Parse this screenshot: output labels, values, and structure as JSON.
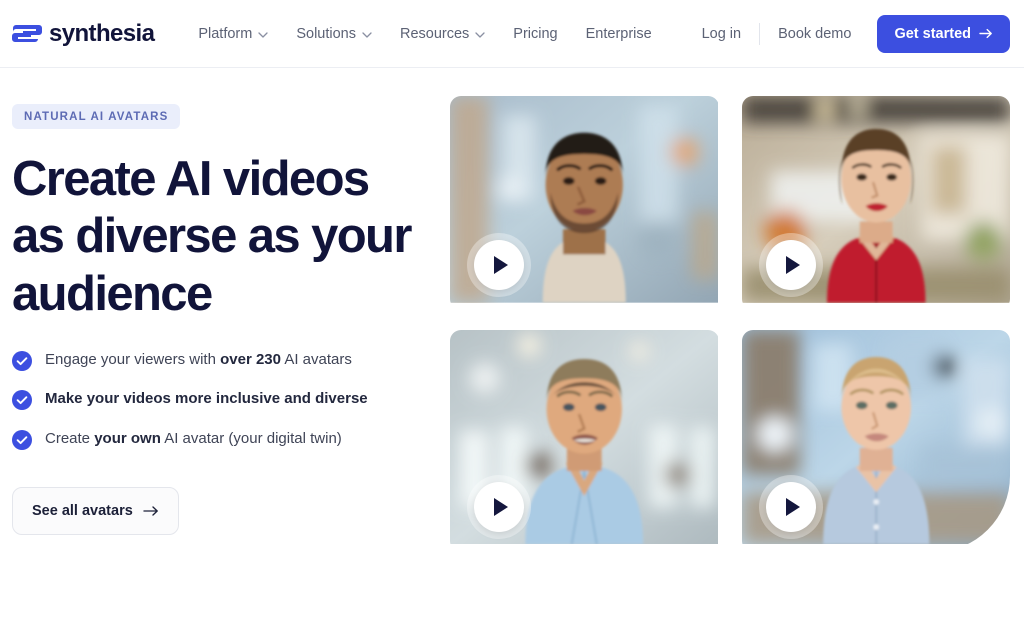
{
  "header": {
    "logo": {
      "text": "synthesia",
      "icon": "synthesia-logo-mark"
    },
    "nav": [
      {
        "label": "Platform",
        "has_dropdown": true
      },
      {
        "label": "Solutions",
        "has_dropdown": true
      },
      {
        "label": "Resources",
        "has_dropdown": true
      },
      {
        "label": "Pricing",
        "has_dropdown": false
      },
      {
        "label": "Enterprise",
        "has_dropdown": false
      }
    ],
    "login_label": "Log in",
    "book_demo_label": "Book demo",
    "cta_label": "Get started",
    "cta_color": "#3c4fe0"
  },
  "hero": {
    "badge": "NATURAL AI AVATARS",
    "badge_bg": "#eaeefb",
    "badge_color": "#5d6bb4",
    "headline": "Create AI videos as diverse as your audience",
    "bullets": [
      {
        "parts": [
          {
            "text": "Engage your viewers with ",
            "bold": false
          },
          {
            "text": "over 230",
            "bold": true
          },
          {
            "text": " AI avatars",
            "bold": false
          }
        ]
      },
      {
        "parts": [
          {
            "text": "Make your videos more inclusive and diverse",
            "bold": true
          }
        ]
      },
      {
        "parts": [
          {
            "text": "Create ",
            "bold": false
          },
          {
            "text": "your own",
            "bold": true
          },
          {
            "text": " AI avatar (your digital twin)",
            "bold": false
          }
        ]
      }
    ],
    "cta_label": "See all avatars"
  },
  "avatar_cards": [
    {
      "name": "avatar-card-1",
      "alt": "Man with short dark hair and beard in beige sweater, blurred indoor background",
      "play_label": "Play",
      "big_corner": false,
      "palette": {
        "bg": "#b9c6d2",
        "mid": "#8aa2b4",
        "subject": "#d8cbbb",
        "hair": "#241c18",
        "skin": "#a8754f"
      }
    },
    {
      "name": "avatar-card-2",
      "alt": "Woman with dark hair tied back wearing red shirt, blurred office background",
      "play_label": "Play",
      "big_corner": false,
      "palette": {
        "bg": "#c8bfae",
        "mid": "#9a9084",
        "subject": "#c41f2c",
        "hair": "#4a3525",
        "skin": "#e2bb9c"
      }
    },
    {
      "name": "avatar-card-3",
      "alt": "Man with greying blond hair in light blue shirt, blurred bright office background",
      "play_label": "Play",
      "big_corner": false,
      "palette": {
        "bg": "#c2cdd3",
        "mid": "#a5b5bd",
        "subject": "#a9c6e0",
        "hair": "#8a7356",
        "skin": "#d8ad8c"
      }
    },
    {
      "name": "avatar-card-4",
      "alt": "Blonde woman in light blue shirt, blurred bright retail background",
      "play_label": "Play",
      "big_corner": true,
      "palette": {
        "bg": "#9fc4dd",
        "mid": "#7fa9c8",
        "subject": "#b7c8dd",
        "hair": "#c9a470",
        "skin": "#e5bfa2"
      }
    }
  ]
}
